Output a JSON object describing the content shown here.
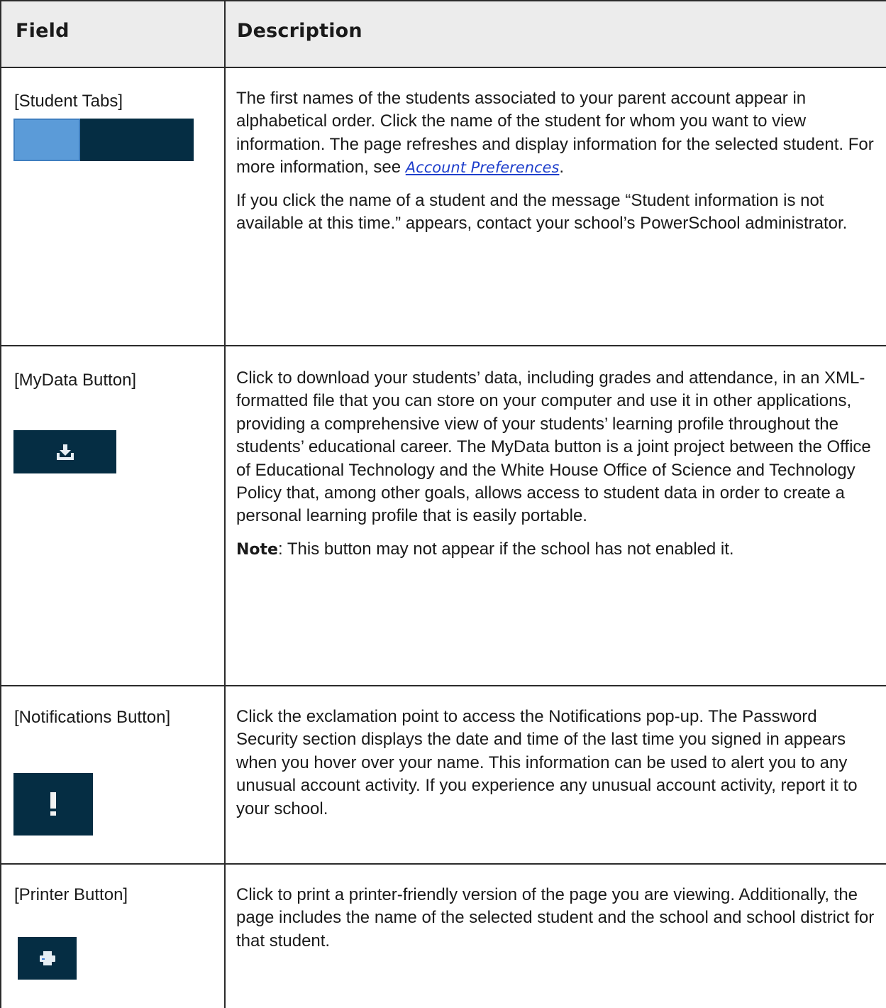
{
  "header": {
    "field_label": "Field",
    "description_label": "Description"
  },
  "rows": [
    {
      "field": "[Student Tabs]",
      "icon": "student-tabs",
      "paragraphs": [
        {
          "text_before_link": "The first names of the students associated to your parent account appear in alphabetical order. Click the name of the student for whom you want to view information. The page refreshes and display information for the selected student. For more information, see ",
          "link_text": "Account Preferences",
          "text_after_link": "."
        },
        {
          "text": "If you click the name of a student and the message “Student information is not available at this time.” appears, contact your school’s PowerSchool administrator."
        }
      ]
    },
    {
      "field": "[MyData Button]",
      "icon": "download-icon",
      "paragraphs": [
        {
          "text": "Click to download your students’ data, including grades and attendance, in an XML-formatted file that you can store on your computer and use it in other applications, providing a comprehensive view of your students’ learning profile throughout the students’ educational career. The MyData button is a joint project between the Office of Educational Technology and the White House Office of Science and Technology Policy that, among other goals, allows access to student data in order to create a personal learning profile that is easily portable."
        },
        {
          "note_label": "Note",
          "note_text": ": This button may not appear if the school has not enabled it."
        }
      ]
    },
    {
      "field": "[Notifications Button]",
      "icon": "exclamation-icon",
      "paragraphs": [
        {
          "text": "Click the exclamation point to access the Notifications pop-up. The Password Security section displays the date and time of the last time you signed in appears when you hover over your name. This information can be used to alert you to any unusual account activity. If you experience any unusual account activity, report it to your school."
        }
      ]
    },
    {
      "field": "[Printer Button]",
      "icon": "printer-icon",
      "paragraphs": [
        {
          "text": "Click to print a printer-friendly version of the page you are viewing. Additionally, the page includes the name of the selected student and the school and school district for that student."
        }
      ]
    }
  ],
  "colors": {
    "header_background": "#ececec",
    "button_background": "#052d43",
    "active_tab": "#5b9bd8",
    "link": "#1f3fcc"
  }
}
